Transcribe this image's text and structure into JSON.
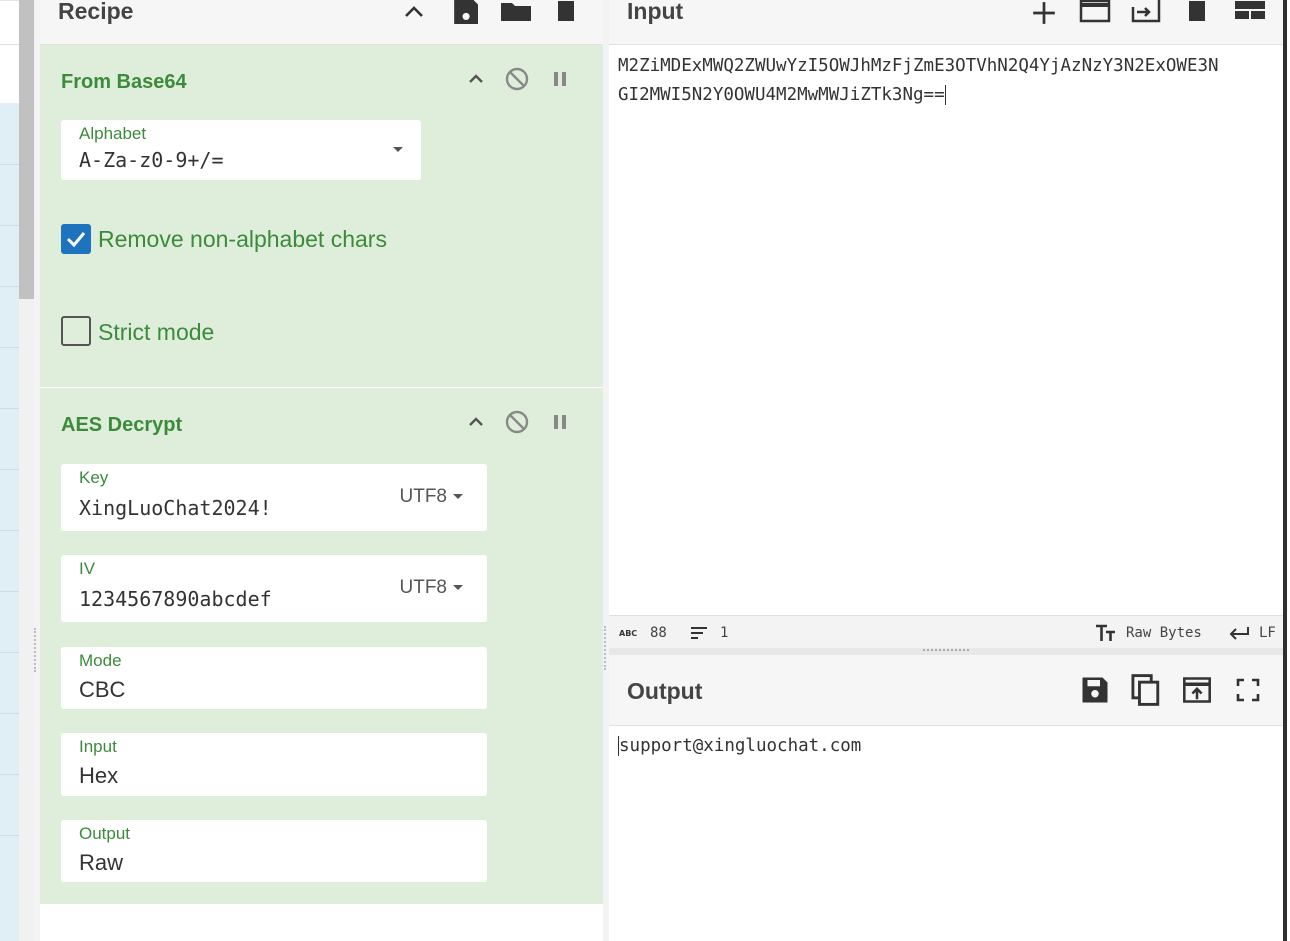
{
  "recipe": {
    "title": "Recipe",
    "operations": [
      {
        "name": "From Base64",
        "alphabet_label": "Alphabet",
        "alphabet_value": "A-Za-z0-9+/=",
        "remove_non_alphabet_label": "Remove non-alphabet chars",
        "remove_non_alphabet_checked": true,
        "strict_mode_label": "Strict mode",
        "strict_mode_checked": false
      },
      {
        "name": "AES Decrypt",
        "key_label": "Key",
        "key_value": "XingLuoChat2024!",
        "key_encoding": "UTF8",
        "iv_label": "IV",
        "iv_value": "1234567890abcdef",
        "iv_encoding": "UTF8",
        "mode_label": "Mode",
        "mode_value": "CBC",
        "input_label": "Input",
        "input_value": "Hex",
        "output_label": "Output",
        "output_value": "Raw"
      }
    ]
  },
  "input": {
    "title": "Input",
    "text_line1": "M2ZiMDExMWQ2ZWUwYzI5OWJhMzFjZmE3OTVhN2Q4YjAzNzY3N2ExOWE3N",
    "text_line2": "GI2MWI5N2Y0OWU4M2MwMWJiZTk3Ng=="
  },
  "status": {
    "chars": "88",
    "lines": "1",
    "encoding": "Raw Bytes",
    "eol": "LF"
  },
  "output": {
    "title": "Output",
    "text": "support@xingluochat.com"
  },
  "colors": {
    "accent_green": "#3c8b3c",
    "op_background": "#dfeedb",
    "checkbox_blue": "#1e73be"
  }
}
